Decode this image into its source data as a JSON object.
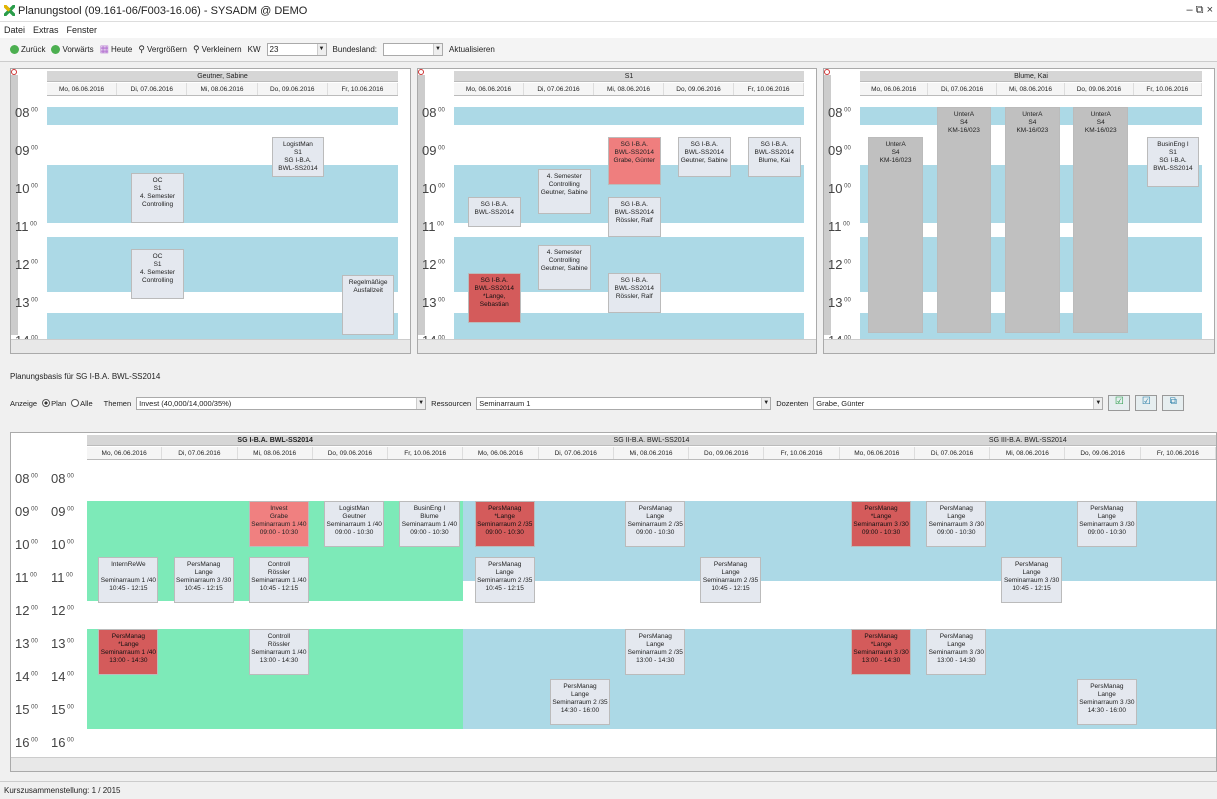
{
  "window": {
    "title": "Planungstool (09.161-06/F003-16.06) - SYSADM @ DEMO",
    "controls": "– ⧉ ×"
  },
  "menu": [
    "Datei",
    "Extras",
    "Fenster"
  ],
  "toolbar": {
    "back": "Zurück",
    "forward": "Vorwärts",
    "today": "Heute",
    "zoom_in": "Vergrößern",
    "zoom_out": "Verkleinern",
    "kw_label": "KW",
    "kw_value": "23",
    "state_label": "Bundesland:",
    "state_value": "",
    "refresh": "Aktualisieren"
  },
  "top_panels": [
    {
      "title": "Geutner, Sabine",
      "days": [
        "Mo, 06.06.2016",
        "Di, 07.06.2016",
        "Mi, 08.06.2016",
        "Do, 09.06.2016",
        "Fr, 10.06.2016"
      ]
    },
    {
      "title": "S1",
      "days": [
        "Mo, 06.06.2016",
        "Di, 07.06.2016",
        "Mi, 08.06.2016",
        "Do, 09.06.2016",
        "Fr, 10.06.2016"
      ]
    },
    {
      "title": "Blume, Kai",
      "days": [
        "Mo, 06.06.2016",
        "Di, 07.06.2016",
        "Mi, 08.06.2016",
        "Do, 09.06.2016",
        "Fr, 10.06.2016"
      ]
    }
  ],
  "hours": [
    "08",
    "09",
    "10",
    "11",
    "12",
    "13",
    "14"
  ],
  "hours_bottom": [
    "08",
    "09",
    "10",
    "11",
    "12",
    "13",
    "14",
    "15",
    "16"
  ],
  "events_p1": [
    "LogistMan\nS1\nSG I-B.A.\nBWL-SS2014",
    "OC\nS1\n4. Semester\nControlling",
    "OC\nS1\n4. Semester\nControlling",
    "Regelmäßige\nAusfallzeit"
  ],
  "events_p2": [
    "SG I-B.A.\nBWL-SS2014\nGrabe, Günter",
    "SG I-B.A.\nBWL-SS2014\nGeutner, Sabine",
    "SG I-B.A.\nBWL-SS2014\nBlume, Kai",
    "4. Semester\nControlling\nGeutner, Sabine",
    "SG I-B.A.\nBWL-SS2014",
    "SG I-B.A.\nBWL-SS2014\nRössler, Ralf",
    "4. Semester\nControlling\nGeutner, Sabine",
    "SG I-B.A.\nBWL-SS2014\n*Lange,\nSebastian",
    "SG I-B.A.\nBWL-SS2014\nRössler, Ralf"
  ],
  "events_p3": [
    "UnterA\nS4\nKM-16/023",
    "UnterA\nS4\nKM-16/023",
    "UnterA\nS4\nKM-16/023",
    "UnterA\nS4\nKM-16/023",
    "BusinEng I\nS1\nSG I-B.A.\nBWL-SS2014"
  ],
  "basis": {
    "title": "Planungsbasis für SG I-B.A. BWL-SS2014",
    "anzeige": "Anzeige",
    "plan": "Plan",
    "alle": "Alle",
    "themen_label": "Themen",
    "themen_value": "Invest (40,000/14,000/35%)",
    "ressourcen_label": "Ressourcen",
    "ressourcen_value": "Seminarraum 1",
    "dozenten_label": "Dozenten",
    "dozenten_value": "Grabe, Günter"
  },
  "groups": [
    {
      "title": "SG I-B.A. BWL-SS2014"
    },
    {
      "title": "SG II-B.A. BWL-SS2014"
    },
    {
      "title": "SG III-B.A. BWL-SS2014"
    }
  ],
  "bottom_days": [
    "Mo, 06.06.2016",
    "Di, 07.06.2016",
    "Mi, 08.06.2016",
    "Do, 09.06.2016",
    "Fr, 10.06.2016"
  ],
  "bottom_events": [
    "Invest\nGrabe\nSeminarraum 1 /40\n09:00 - 10:30",
    "LogistMan\nGeutner\nSeminarraum 1 /40\n09:00 - 10:30",
    "BusinEng I\nBlume\nSeminarraum 1 /40\n09:00 - 10:30",
    "PersManag\n*Lange\nSeminarraum 2 /35\n09:00 - 10:30",
    "PersManag\nLange\nSeminarraum 2 /35\n09:00 - 10:30",
    "PersManag\n*Lange\nSeminarraum 3 /30\n09:00 - 10:30",
    "PersManag\nLange\nSeminarraum 3 /30\n09:00 - 10:30",
    "PersManag\nLange\nSeminarraum 3 /30\n09:00 - 10:30",
    "InternReWe\n\nSeminarraum 1 /40\n10:45 - 12:15",
    "PersManag\nLange\nSeminarraum 3 /30\n10:45 - 12:15",
    "Controll\nRössler\nSeminarraum 1 /40\n10:45 - 12:15",
    "PersManag\nLange\nSeminarraum 2 /35\n10:45 - 12:15",
    "PersManag\nLange\nSeminarraum 2 /35\n10:45 - 12:15",
    "PersManag\nLange\nSeminarraum 3 /30\n10:45 - 12:15",
    "PersManag\n*Lange\nSeminarraum 1 /40\n13:00 - 14:30",
    "Controll\nRössler\nSeminarraum 1 /40\n13:00 - 14:30",
    "PersManag\nLange\nSeminarraum 2 /35\n13:00 - 14:30",
    "PersManag\n*Lange\nSeminarraum 3 /30\n13:00 - 14:30",
    "PersManag\nLange\nSeminarraum 3 /30\n13:00 - 14:30",
    "PersManag\nLange\nSeminarraum 2 /35\n14:30 - 16:00",
    "PersManag\nLange\nSeminarraum 3 /30\n14:30 - 16:00"
  ],
  "status": "Kurszusammenstellung: 1 / 2015"
}
